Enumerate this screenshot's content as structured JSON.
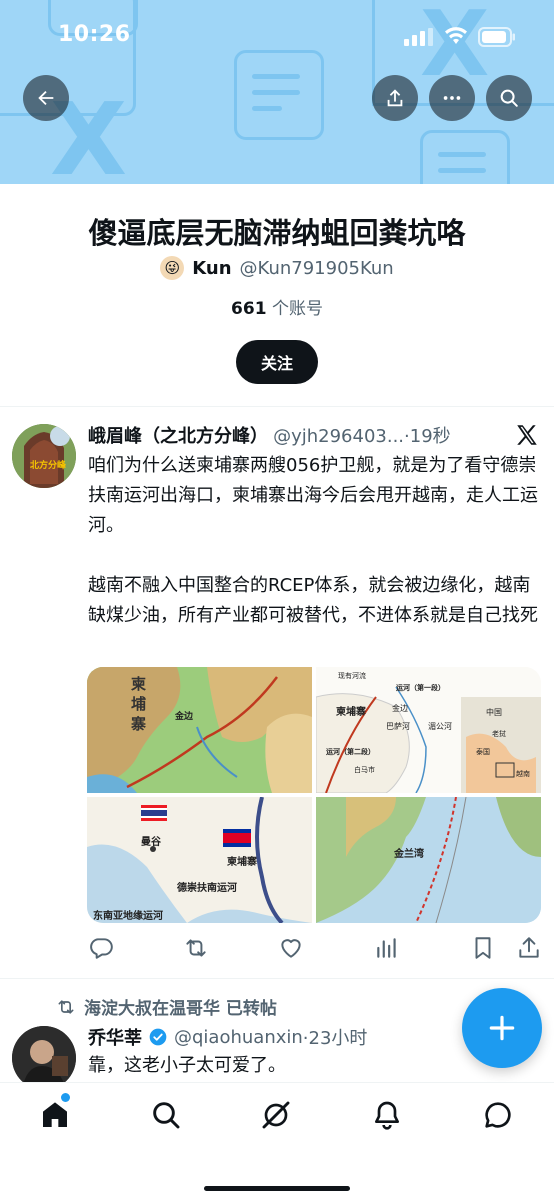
{
  "status_bar": {
    "time": "10:26"
  },
  "header": {
    "back_icon": "arrow-left-icon",
    "share_icon": "share-icon",
    "more_icon": "more-icon",
    "search_icon": "search-icon",
    "banner_color": "#9fd6f7"
  },
  "list": {
    "title": "傻逼底层无脑滞纳蛆回粪坑咯",
    "owner_emoji": "😜",
    "owner_name": "Kun",
    "owner_handle": "@Kun791905Kun",
    "member_count": "661",
    "member_label": " 个账号",
    "follow_label": "关注"
  },
  "tweets": [
    {
      "name": "峨眉峰（之北方分峰）",
      "handle": "@yjh296403...",
      "time": "·19秒",
      "text": "咱们为什么送柬埔寨两艘056护卫舰，就是为了看守德崇扶南运河出海口，柬埔寨出海今后会甩开越南，走人工运河。\n\n越南不融入中国整合的RCEP体系，就会被边缘化，越南缺煤少油，所有产业都可被替代，不进体系就是自己找死",
      "avatar_label": "北方分峰",
      "media": {
        "map1": {
          "label1": "柬",
          "label2": "埔",
          "label3": "寨",
          "place": "金边"
        },
        "map2": {
          "legend": "现有河流",
          "canal1": "运河（第一段）",
          "canal2": "运河（第二段）",
          "country": "柬埔寨",
          "city1": "金边",
          "city2": "巴萨河",
          "city3": "湄公河",
          "city4": "白马市",
          "inset1": "中国",
          "inset2": "老挝",
          "inset3": "泰国",
          "inset4": "越南"
        },
        "map3": {
          "city1": "曼谷",
          "city2": "柬埔寨",
          "canal": "德崇扶南运河",
          "caption": "东南亚地缘运河"
        },
        "map4": {
          "label": "金兰湾"
        }
      }
    },
    {
      "retweet_by": "海淀大叔在温哥华 已转帖",
      "name": "乔华莘",
      "handle": "@qiaohuanxin",
      "time": "·23小时",
      "text": "靠，这老小子太可爱了。"
    }
  ],
  "nav": [
    "home-icon",
    "search-icon",
    "grok-icon",
    "notifications-icon",
    "messages-icon"
  ],
  "accent": "#1d9bf0"
}
